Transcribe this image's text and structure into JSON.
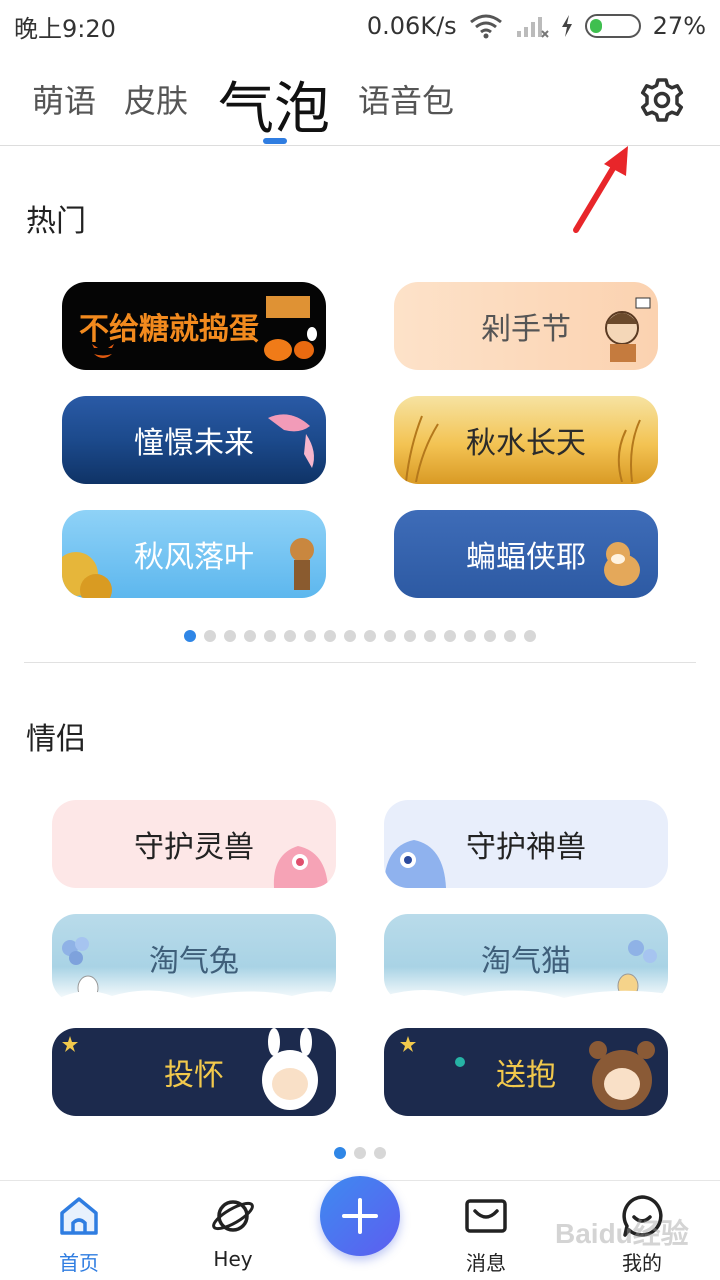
{
  "status_bar": {
    "time": "晚上9:20",
    "speed": "0.06K/s",
    "battery": "27%",
    "battery_level": 0.27
  },
  "tabs": [
    {
      "label": "萌语"
    },
    {
      "label": "皮肤"
    },
    {
      "label": "气泡",
      "active": true
    },
    {
      "label": "语音包"
    }
  ],
  "hot": {
    "title": "热门",
    "bubbles": [
      {
        "label": "不给糖就捣蛋"
      },
      {
        "label": "剁手节"
      },
      {
        "label": "憧憬未来"
      },
      {
        "label": "秋水长天"
      },
      {
        "label": "秋风落叶"
      },
      {
        "label": "蝙蝠侠耶"
      }
    ],
    "page_count": 18,
    "current_page": 1
  },
  "couple": {
    "title": "情侣",
    "bubbles": [
      {
        "label": "守护灵兽"
      },
      {
        "label": "守护神兽"
      },
      {
        "label": "淘气兔"
      },
      {
        "label": "淘气猫"
      },
      {
        "label": "投怀"
      },
      {
        "label": "送抱"
      }
    ],
    "page_count": 3,
    "current_page": 1
  },
  "bottom_nav": {
    "home": "首页",
    "hey": "Hey",
    "messages": "消息",
    "mine": "我的"
  },
  "colors": {
    "accent": "#2f7de1",
    "annotation_arrow": "#e8262a"
  },
  "watermark": "Baidu经验"
}
